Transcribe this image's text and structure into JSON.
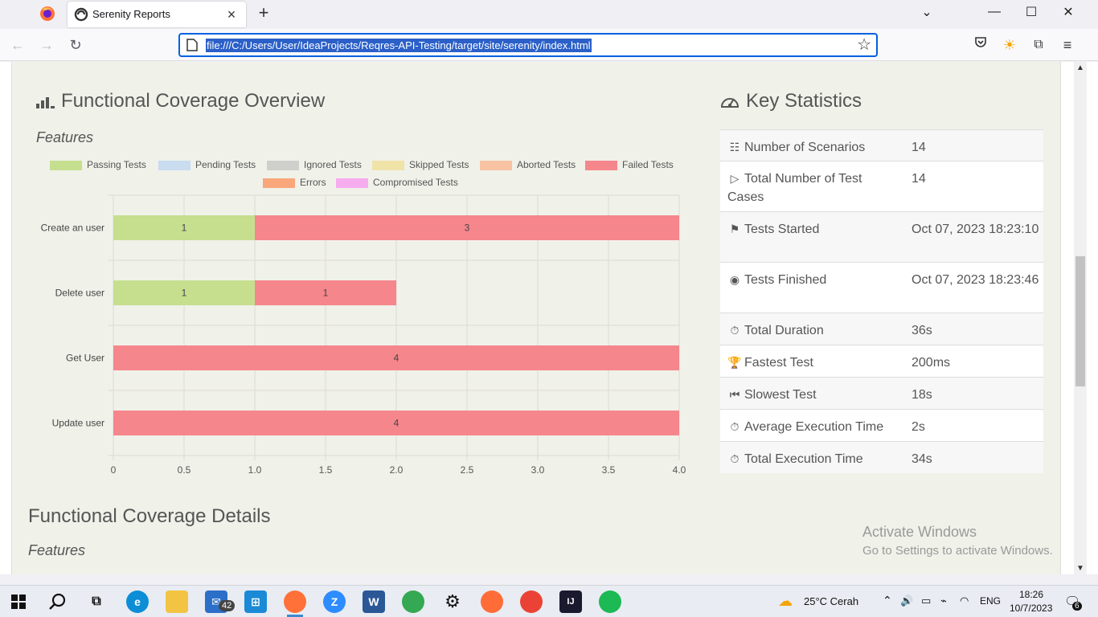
{
  "browser": {
    "tab_title": "Serenity Reports",
    "url": "file:///C:/Users/User/IdeaProjects/Reqres-API-Testing/target/site/serenity/index.html"
  },
  "coverage": {
    "title": "Functional Coverage Overview",
    "subtitle": "Features"
  },
  "legend": [
    {
      "label": "Passing Tests",
      "color": "#c5df8f"
    },
    {
      "label": "Pending Tests",
      "color": "#c9dcf0"
    },
    {
      "label": "Ignored Tests",
      "color": "#cfcfcb"
    },
    {
      "label": "Skipped Tests",
      "color": "#f0e3a8"
    },
    {
      "label": "Aborted Tests",
      "color": "#f7c3a3"
    },
    {
      "label": "Failed Tests",
      "color": "#f5868c"
    },
    {
      "label": "Errors",
      "color": "#f9a77a"
    },
    {
      "label": "Compromised Tests",
      "color": "#f6acef"
    }
  ],
  "chart_data": {
    "type": "bar",
    "orientation": "horizontal",
    "stacked": true,
    "categories": [
      "Create an user",
      "Delete user",
      "Get User",
      "Update user"
    ],
    "series": [
      {
        "name": "Passing Tests",
        "values": [
          1,
          1,
          0,
          0
        ],
        "color": "#c5df8f"
      },
      {
        "name": "Failed Tests",
        "values": [
          3,
          1,
          4,
          4
        ],
        "color": "#f5868c"
      }
    ],
    "xticks": [
      "0",
      "0.5",
      "1.0",
      "1.5",
      "2.0",
      "2.5",
      "3.0",
      "3.5",
      "4.0"
    ],
    "xlim": [
      0,
      4
    ],
    "grid": true,
    "legend": "top"
  },
  "key_stats": {
    "title": "Key Statistics",
    "rows": [
      {
        "icon": "list-icon",
        "glyph": "☷",
        "label": "Number of Scenarios",
        "value": "14"
      },
      {
        "icon": "play-icon",
        "glyph": "▷",
        "label": "Total Number of Test Cases",
        "value": "14"
      },
      {
        "icon": "flag-icon",
        "glyph": "⚑",
        "label": "Tests Started",
        "value": "Oct 07, 2023 18:23:10"
      },
      {
        "icon": "stop-circle-icon",
        "glyph": "◉",
        "label": "Tests Finished",
        "value": "Oct 07, 2023 18:23:46"
      },
      {
        "icon": "stopwatch-icon",
        "glyph": "⏱",
        "label": "Total Duration",
        "value": "36s"
      },
      {
        "icon": "trophy-icon",
        "glyph": "🏆",
        "label": "Fastest Test",
        "value": "200ms"
      },
      {
        "icon": "step-backward-icon",
        "glyph": "⏮",
        "label": "Slowest Test",
        "value": "18s"
      },
      {
        "icon": "stopwatch-icon",
        "glyph": "⏱",
        "label": "Average Execution Time",
        "value": "2s"
      },
      {
        "icon": "stopwatch-solid-icon",
        "glyph": "⏱",
        "label": "Total Execution Time",
        "value": "34s"
      }
    ]
  },
  "details": {
    "title": "Functional Coverage Details",
    "subtitle": "Features"
  },
  "watermark": {
    "line1": "Activate Windows",
    "line2": "Go to Settings to activate Windows."
  },
  "taskbar": {
    "mail_badge": "42",
    "weather": "25°C  Cerah",
    "lang": "ENG",
    "time": "18:26",
    "date": "10/7/2023",
    "notif_count": "6"
  }
}
